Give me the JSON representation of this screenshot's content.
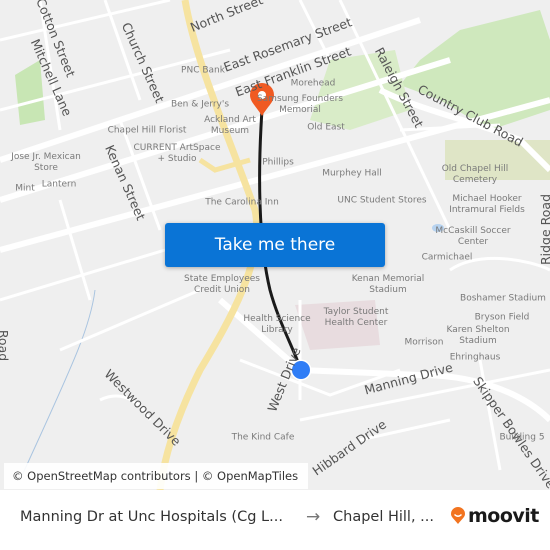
{
  "map": {
    "street_labels": [
      "North Street",
      "East Rosemary Street",
      "East Franklin Street",
      "Raleigh Street",
      "Country Club Road",
      "Cotton Street",
      "Mitchell Lane",
      "Church Street",
      "Kenan Street",
      "Ridge Road",
      "West Drive",
      "Manning Drive",
      "Hibbard Drive",
      "Skipper Bowles Drive",
      "Westwood Drive",
      "Road"
    ],
    "poi_labels": [
      "PNC Bank",
      "Ben & Jerry's",
      "Ackland Art Museum",
      "Morehead",
      "Samsung Founders Memorial",
      "Old East",
      "Chapel Hill Florist",
      "CURRENT ArtSpace + Studio",
      "Jose Jr. Mexican Store",
      "Mint",
      "Lantern",
      "Phillips",
      "Murphey Hall",
      "The Carolina Inn",
      "UNC Student Stores",
      "Old Chapel Hill Cemetery",
      "Michael Hooker Intramural Fields",
      "McCaskill Soccer Center",
      "Carmichael",
      "State Employees Credit Union",
      "Kenan Memorial Stadium",
      "Boshamer Stadium",
      "Bryson Field",
      "Taylor Student Health Center",
      "Health Science Library",
      "Karen Shelton Stadium",
      "Morrison",
      "Ehringhaus",
      "Building 5",
      "The Kind Cafe"
    ],
    "destination_marker": {
      "icon": "map-pin-icon",
      "color": "#f05a22"
    },
    "origin_marker": {
      "icon": "circle-dot-icon",
      "color": "#2f7df6"
    },
    "route_color": "#1a1a1a"
  },
  "cta": {
    "label": "Take me there",
    "color": "#0a74d6"
  },
  "attribution": "© OpenStreetMap contributors | © OpenMapTiles",
  "footer": {
    "from": "Manning Dr at Unc Hospitals (Cg L...",
    "arrow": "→",
    "to": "Chapel Hill, ...",
    "logo_text": "moovit",
    "logo_color": "#f27420"
  }
}
